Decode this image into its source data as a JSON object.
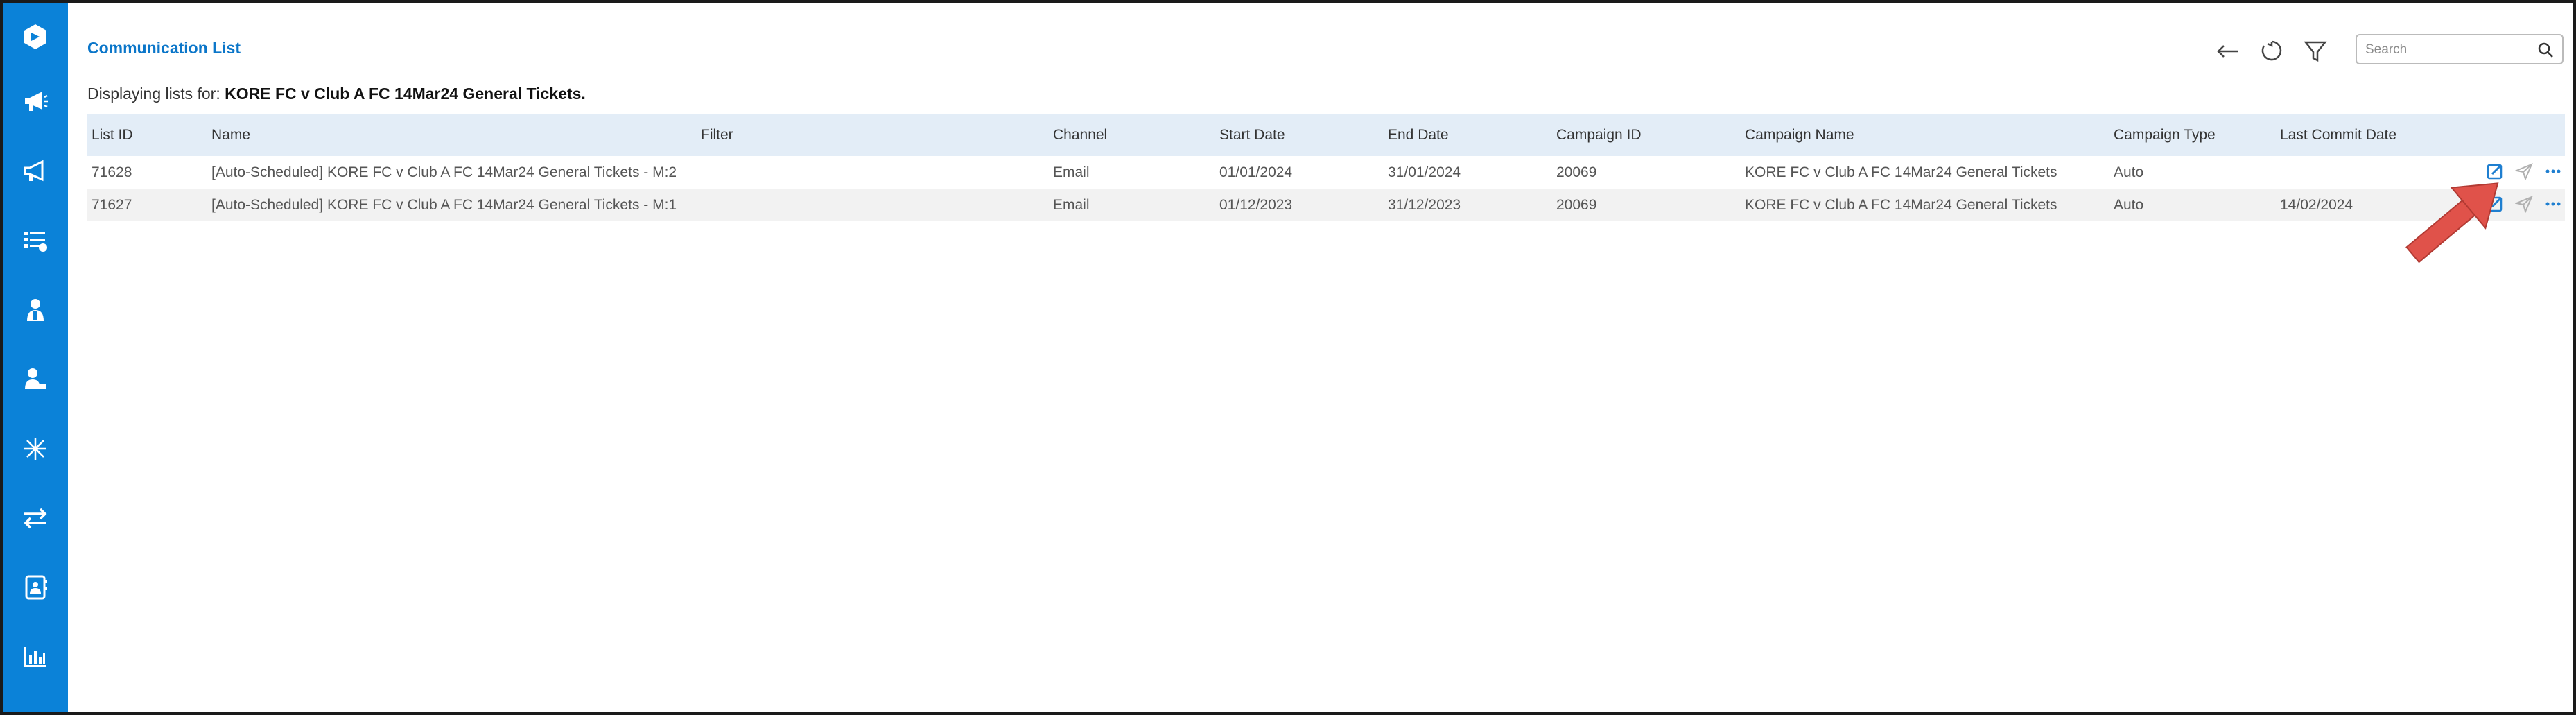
{
  "page": {
    "title": "Communication List",
    "subtitle_prefix": "Displaying lists for:",
    "subtitle_name": "KORE FC v Club A FC 14Mar24 General Tickets.",
    "search_placeholder": "Search"
  },
  "sidebar": {
    "items": [
      "logo-icon",
      "megaphone-icon",
      "megaphone-outline-icon",
      "list-icon",
      "user-icon",
      "user-desk-icon",
      "network-icon",
      "swap-icon",
      "contact-card-icon",
      "bar-chart-icon"
    ]
  },
  "toolbar": {
    "icons": [
      "back-arrow-icon",
      "refresh-icon",
      "filter-icon",
      "search-icon"
    ]
  },
  "table": {
    "columns": [
      "List ID",
      "Name",
      "Filter",
      "Channel",
      "Start Date",
      "End Date",
      "Campaign ID",
      "Campaign Name",
      "Campaign Type",
      "Last Commit Date"
    ],
    "rows": [
      {
        "list_id": "71628",
        "name": "[Auto-Scheduled] KORE FC v Club A FC 14Mar24 General Tickets - M:2",
        "filter": "",
        "channel": "Email",
        "start_date": "01/01/2024",
        "end_date": "31/01/2024",
        "campaign_id": "20069",
        "campaign_name": "KORE FC v Club A FC 14Mar24 General Tickets",
        "campaign_type": "Auto",
        "last_commit_date": ""
      },
      {
        "list_id": "71627",
        "name": "[Auto-Scheduled] KORE FC v Club A FC 14Mar24 General Tickets - M:1",
        "filter": "",
        "channel": "Email",
        "start_date": "01/12/2023",
        "end_date": "31/12/2023",
        "campaign_id": "20069",
        "campaign_name": "KORE FC v Club A FC 14Mar24 General Tickets",
        "campaign_type": "Auto",
        "last_commit_date": "14/02/2024"
      }
    ],
    "row_actions": [
      "edit-icon",
      "send-icon",
      "more-icon"
    ]
  },
  "colors": {
    "sidebar": "#0b82d8",
    "title": "#0b76c9",
    "header_bg": "#e3edf7",
    "annotation_arrow": "#e0524a"
  }
}
